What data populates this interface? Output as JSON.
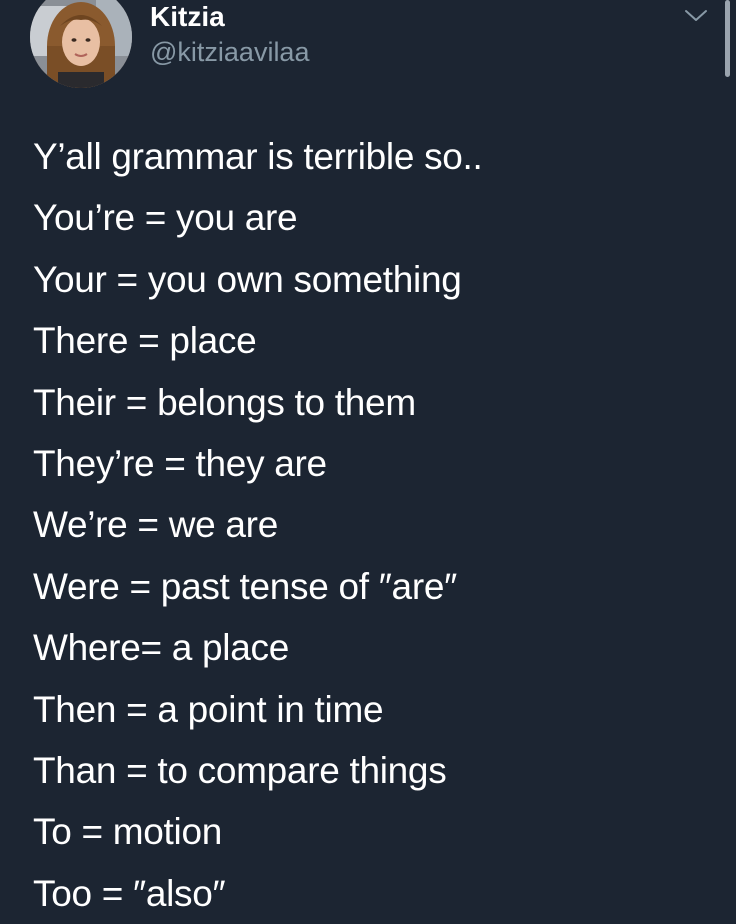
{
  "user": {
    "display_name": "Kitzia",
    "handle": "@kitziaavilaa"
  },
  "icons": {
    "menu": "chevron-down-icon"
  },
  "colors": {
    "background": "#1c2532",
    "text": "#ffffff",
    "secondary_text": "#8899a6"
  },
  "tweet": {
    "lines": [
      "Y’all grammar is terrible so..",
      "You’re = you are",
      "Your = you own something",
      "There = place",
      "Their = belongs to them",
      "They’re = they are",
      "We’re = we are",
      "Were = past tense of ″are″",
      "Where= a place",
      "Then = a point in time",
      "Than = to compare things",
      "To = motion",
      "Too = ″also″"
    ]
  }
}
